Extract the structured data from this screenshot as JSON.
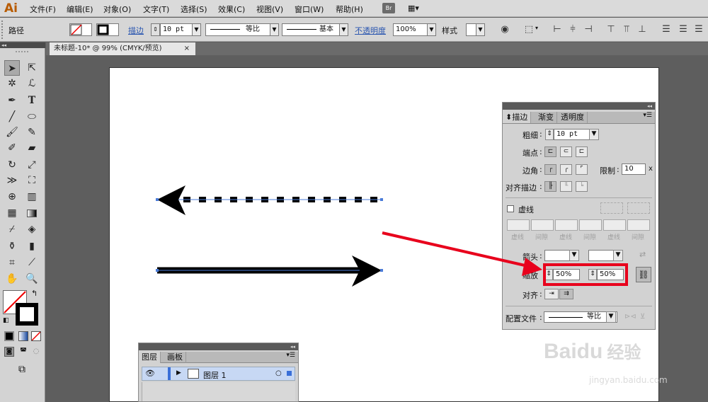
{
  "app": {
    "logo": "Ai"
  },
  "menu": [
    "文件(F)",
    "编辑(E)",
    "对象(O)",
    "文字(T)",
    "选择(S)",
    "效果(C)",
    "视图(V)",
    "窗口(W)",
    "帮助(H)"
  ],
  "bridge": "Br",
  "control": {
    "object_type": "路径",
    "stroke_label": "描边",
    "stroke_weight": "10 pt",
    "profile": "等比",
    "brush": "基本",
    "opacity_label": "不透明度",
    "opacity": "100%",
    "style_label": "样式"
  },
  "document_tab": {
    "title": "未标题-10* @ 99% (CMYK/预览)",
    "close": "×"
  },
  "stroke_panel": {
    "tabs": [
      "描边",
      "渐变",
      "透明度"
    ],
    "weight_label": "粗细",
    "weight": "10 pt",
    "cap_label": "端点",
    "corner_label": "边角",
    "limit_label": "限制",
    "limit": "10",
    "limit_unit": "x",
    "align_label": "对齐描边",
    "dashed_label": "虚线",
    "dash_labels": [
      "虚线",
      "间隙",
      "虚线",
      "间隙",
      "虚线",
      "间隙"
    ],
    "arrowheads_label": "箭头",
    "scale_label": "缩放",
    "scale_start": "50%",
    "scale_end": "50%",
    "arrow_align_label": "对齐",
    "profile_label": "配置文件",
    "profile": "等比"
  },
  "layers_panel": {
    "tabs": [
      "图层",
      "画板"
    ],
    "layer_name": "图层 1"
  },
  "watermark": {
    "brand": "Baidu",
    "cn": "经验",
    "url": "jingyan.baidu.com"
  },
  "colors": {
    "highlight": "#e8001c",
    "accent_link": "#2a56b0",
    "layer_row": "#c7d8f4"
  }
}
